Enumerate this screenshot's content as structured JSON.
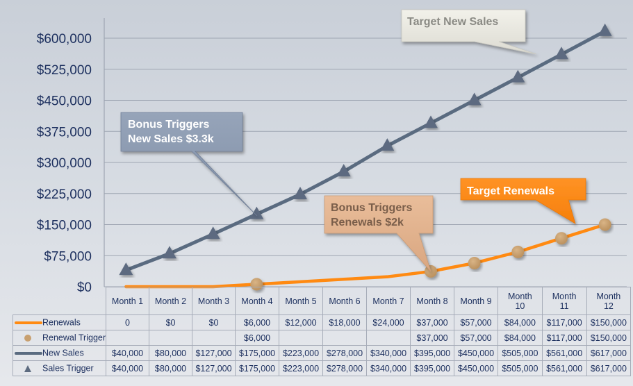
{
  "colors": {
    "renewals": "#ff8a12",
    "renewal_trigger": "#c8a070",
    "new_sales": "#5a6b80",
    "sales_trigger": "#5d6b80",
    "axis_text": "#1c2f5e"
  },
  "callouts": {
    "target_new_sales": "Target New Sales",
    "bonus_new_sales_line1": "Bonus Triggers",
    "bonus_new_sales_line2": "New Sales $3.3k",
    "bonus_renewals_line1": "Bonus Triggers",
    "bonus_renewals_line2": "Renewals $2k",
    "target_renewals": "Target Renewals"
  },
  "chart_data": {
    "type": "line",
    "title": "",
    "xlabel": "",
    "ylabel": "",
    "ylim": [
      0,
      600000
    ],
    "grid": true,
    "y_ticks": [
      0,
      75000,
      150000,
      225000,
      300000,
      375000,
      450000,
      525000,
      600000
    ],
    "y_tick_labels": [
      "$0",
      "$75,000",
      "$150,000",
      "$225,000",
      "$300,000",
      "$375,000",
      "$450,000",
      "$525,000",
      "$600,000"
    ],
    "categories": [
      "Month 1",
      "Month 2",
      "Month 3",
      "Month 4",
      "Month 5",
      "Month 6",
      "Month 7",
      "Month 8",
      "Month 9",
      "Month 10",
      "Month 11",
      "Month 12"
    ],
    "legend_placement": "data-table-below",
    "series": [
      {
        "name": "Renewals",
        "kind": "line",
        "values": [
          0,
          0,
          0,
          6000,
          12000,
          18000,
          24000,
          37000,
          57000,
          84000,
          117000,
          150000
        ]
      },
      {
        "name": "Renewal Trigger",
        "kind": "marker-circle",
        "values": [
          null,
          null,
          null,
          6000,
          null,
          null,
          null,
          37000,
          57000,
          84000,
          117000,
          150000
        ]
      },
      {
        "name": "New Sales",
        "kind": "line",
        "values": [
          40000,
          80000,
          127000,
          175000,
          223000,
          278000,
          340000,
          395000,
          450000,
          505000,
          561000,
          617000
        ]
      },
      {
        "name": "Sales Trigger",
        "kind": "marker-triangle",
        "values": [
          40000,
          80000,
          127000,
          175000,
          223000,
          278000,
          340000,
          395000,
          450000,
          505000,
          561000,
          617000
        ]
      }
    ]
  },
  "table": {
    "headers": [
      "Month 1",
      "Month 2",
      "Month 3",
      "Month 4",
      "Month 5",
      "Month 6",
      "Month 7",
      "Month 8",
      "Month 9",
      "Month 10",
      "Month 11",
      "Month 12"
    ],
    "rows": [
      {
        "label": "Renewals",
        "key": "line-orange",
        "cells": [
          "0",
          "$0",
          "$0",
          "$6,000",
          "$12,000",
          "$18,000",
          "$24,000",
          "$37,000",
          "$57,000",
          "$84,000",
          "$117,000",
          "$150,000"
        ]
      },
      {
        "label": "Renewal Trigger",
        "key": "dot",
        "cells": [
          "",
          "",
          "",
          "$6,000",
          "",
          "",
          "",
          "$37,000",
          "$57,000",
          "$84,000",
          "$117,000",
          "$150,000"
        ]
      },
      {
        "label": "New Sales",
        "key": "line-gray",
        "cells": [
          "$40,000",
          "$80,000",
          "$127,000",
          "$175,000",
          "$223,000",
          "$278,000",
          "$340,000",
          "$395,000",
          "$450,000",
          "$505,000",
          "$561,000",
          "$617,000"
        ]
      },
      {
        "label": "Sales Trigger",
        "key": "triangle",
        "cells": [
          "$40,000",
          "$80,000",
          "$127,000",
          "$175,000",
          "$223,000",
          "$278,000",
          "$340,000",
          "$395,000",
          "$450,000",
          "$505,000",
          "$561,000",
          "$617,000"
        ]
      }
    ]
  }
}
